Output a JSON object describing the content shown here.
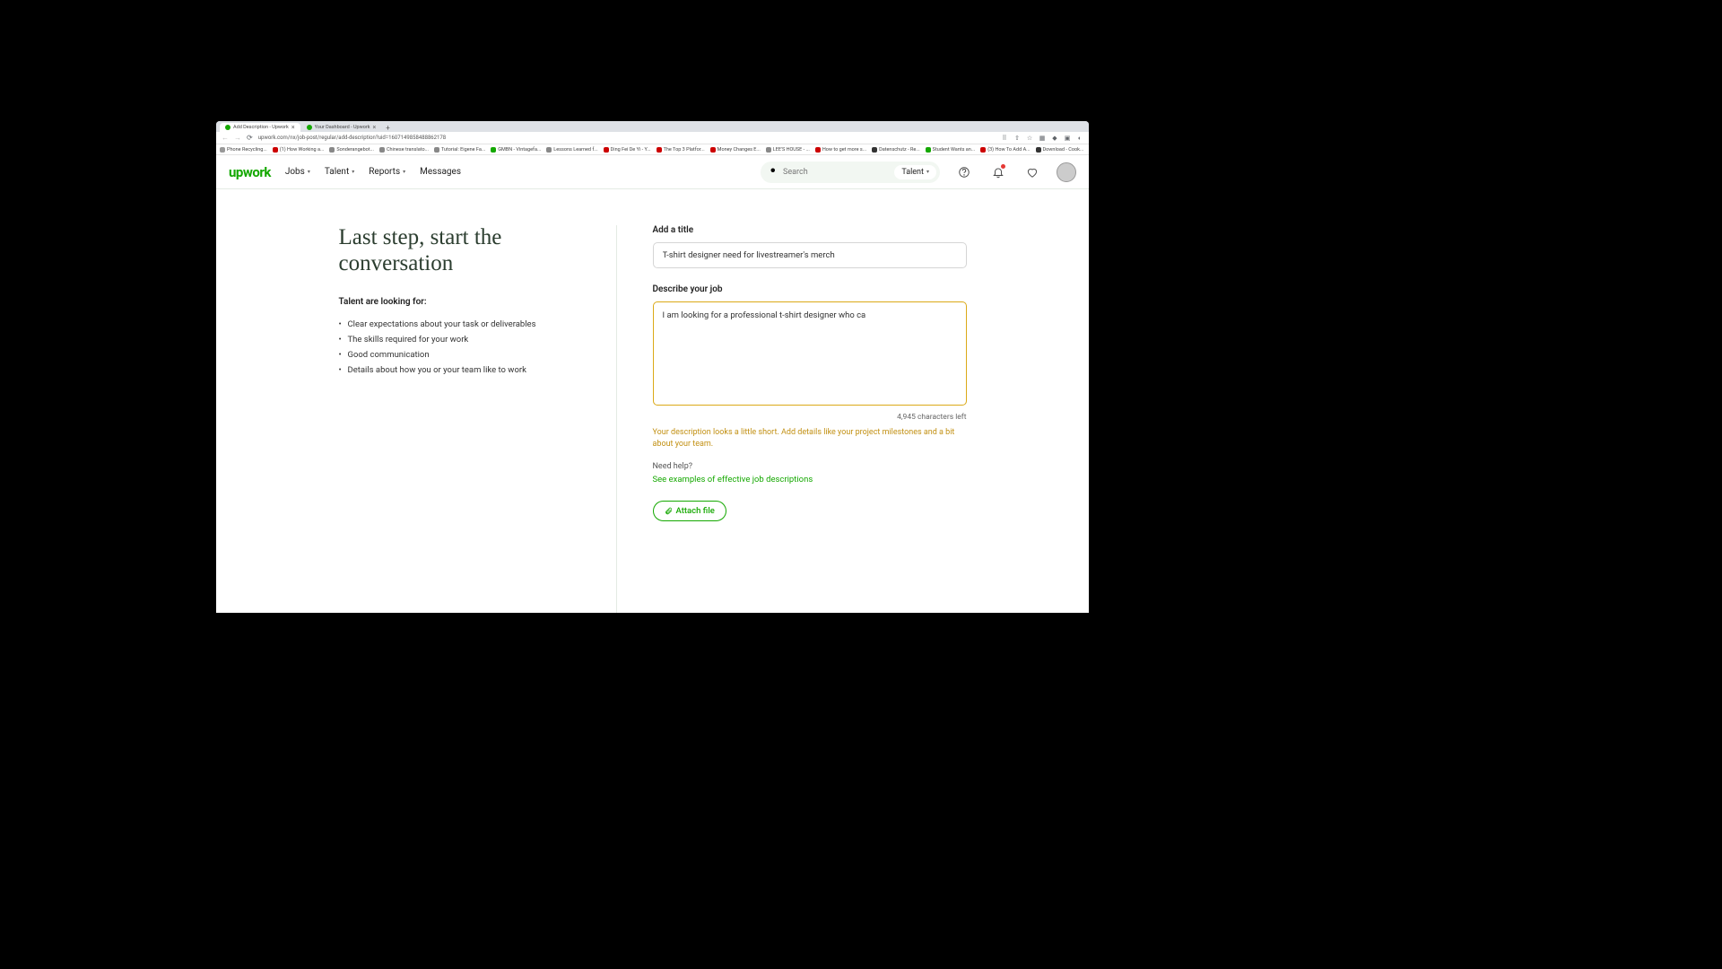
{
  "browser": {
    "tabs": [
      {
        "title": "Add Description - Upwork",
        "active": true
      },
      {
        "title": "Your Dashboard - Upwork",
        "active": false
      }
    ],
    "url": "upwork.com/nx/job-post/regular/add-description?uid=1607149858488862178",
    "bookmarks": [
      {
        "label": "Phone Recycling...",
        "color": "#999"
      },
      {
        "label": "(1) How Working a...",
        "color": "#c00"
      },
      {
        "label": "Sonderangebot...",
        "color": "#888"
      },
      {
        "label": "Chinese translato...",
        "color": "#888"
      },
      {
        "label": "Tutorial: Eigene Fa...",
        "color": "#888"
      },
      {
        "label": "GMBN - Vintagefa...",
        "color": "#14a800"
      },
      {
        "label": "Lessons Learned f...",
        "color": "#888"
      },
      {
        "label": "Ding Fei De Yi - Y...",
        "color": "#c00"
      },
      {
        "label": "The Top 3 Platfor...",
        "color": "#c00"
      },
      {
        "label": "Money Changes E...",
        "color": "#c00"
      },
      {
        "label": "LEE'S HOUSE - ...",
        "color": "#888"
      },
      {
        "label": "How to get more s...",
        "color": "#c00"
      },
      {
        "label": "Datenschutz - Re...",
        "color": "#333"
      },
      {
        "label": "Student Wants an...",
        "color": "#14a800"
      },
      {
        "label": "(3) How To Add A...",
        "color": "#c00"
      },
      {
        "label": "Download - Cook...",
        "color": "#333"
      }
    ]
  },
  "nav": {
    "items": [
      "Jobs",
      "Talent",
      "Reports",
      "Messages"
    ],
    "search_placeholder": "Search",
    "search_filter": "Talent"
  },
  "page": {
    "heading": "Last step, start the conversation",
    "subhead": "Talent are looking for:",
    "tips": [
      "Clear expectations about your task or deliverables",
      "The skills required for your work",
      "Good communication",
      "Details about how you or your team like to work"
    ],
    "title_label": "Add a title",
    "title_value": "T-shirt designer need for livestreamer's merch",
    "desc_label": "Describe your job",
    "desc_value": "I am looking for a professional t-shirt designer who ca",
    "counter": "4,945 characters left",
    "warning": "Your description looks a little short. Add details like your project milestones and a bit about your team.",
    "help_label": "Need help?",
    "help_link": "See examples of effective job descriptions",
    "attach_label": "Attach file"
  }
}
